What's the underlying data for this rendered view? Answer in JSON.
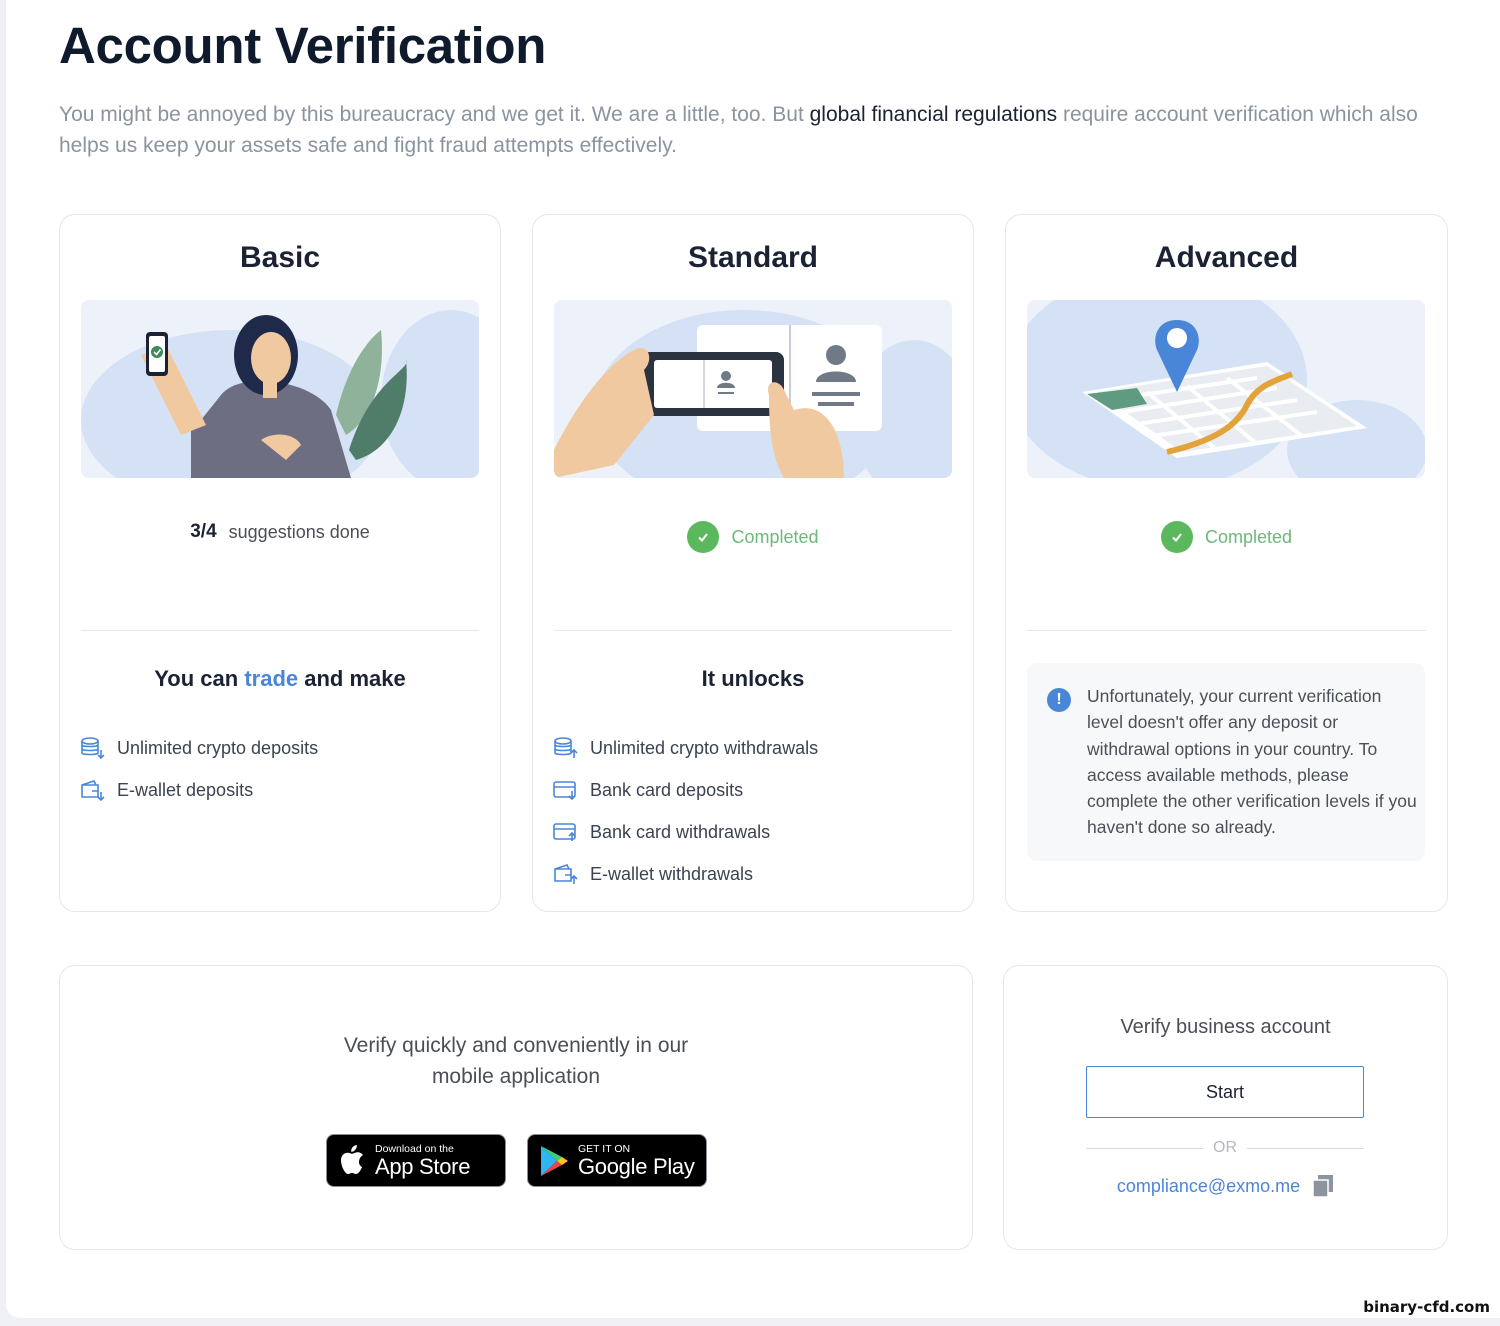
{
  "page": {
    "title": "Account Verification",
    "intro_before": "You might be annoyed by this bureaucracy and we get it. We are a little, too. But ",
    "intro_link": "global financial regulations",
    "intro_after": " require account verification which also helps us keep your assets safe and fight fraud attempts effectively."
  },
  "tiers": {
    "basic": {
      "title": "Basic",
      "progress_done": "3/4",
      "progress_label": "suggestions done",
      "sub_before": "You can ",
      "sub_accent": "trade",
      "sub_after": " and make",
      "perks": [
        {
          "label": "Unlimited crypto deposits",
          "icon": "crypto-deposit-icon"
        },
        {
          "label": "E-wallet deposits",
          "icon": "ewallet-deposit-icon"
        }
      ]
    },
    "standard": {
      "title": "Standard",
      "status": "Completed",
      "sub_title": "It unlocks",
      "perks": [
        {
          "label": "Unlimited crypto withdrawals",
          "icon": "crypto-withdrawal-icon"
        },
        {
          "label": "Bank card deposits",
          "icon": "bank-card-deposit-icon"
        },
        {
          "label": "Bank card withdrawals",
          "icon": "bank-card-withdrawal-icon"
        },
        {
          "label": "E-wallet withdrawals",
          "icon": "ewallet-withdrawal-icon"
        }
      ]
    },
    "advanced": {
      "title": "Advanced",
      "status": "Completed",
      "notice": "Unfortunately, your current verification level doesn't offer any deposit or withdrawal options in your country. To access available methods, please complete the other verification levels if you haven't done so already."
    }
  },
  "mobile": {
    "lead_line1": "Verify quickly and conveniently in our",
    "lead_line2": "mobile application",
    "app_store_small": "Download on the",
    "app_store_big": "App Store",
    "google_play_small": "GET IT ON",
    "google_play_big": "Google Play"
  },
  "business": {
    "heading": "Verify business account",
    "start_label": "Start",
    "or_label": "OR",
    "email": "compliance@exmo.me"
  },
  "watermark": "binary-cfd.com",
  "colors": {
    "accent_blue": "#4a86d8",
    "success_green": "#5cb85c",
    "title_dark": "#0f1b2d",
    "muted_text": "#8a949f"
  }
}
